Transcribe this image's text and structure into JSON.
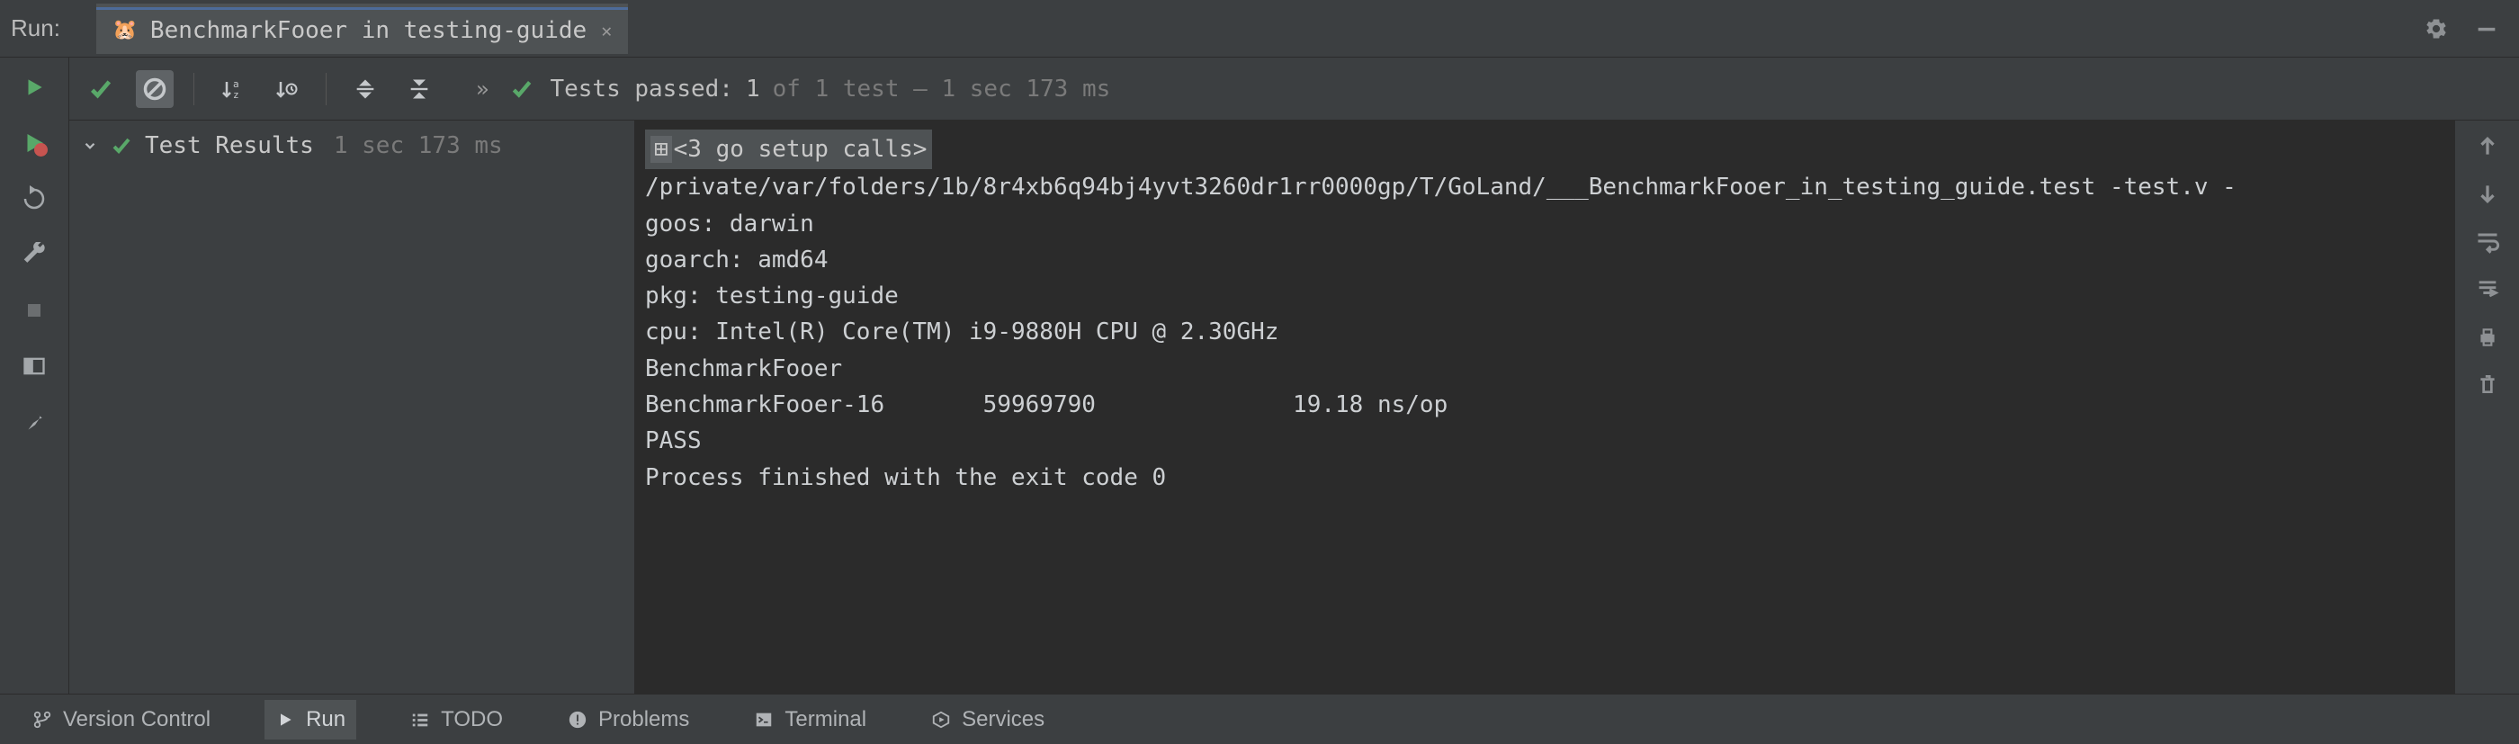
{
  "topbar": {
    "run_label": "Run:",
    "tab_icon": "🐹",
    "tab_title": "BenchmarkFooer in testing-guide"
  },
  "status": {
    "chevrons": "»",
    "label": "Tests passed:",
    "count": "1",
    "of_total": "of 1 test – 1 sec 173 ms"
  },
  "tree": {
    "root_label": "Test Results",
    "root_time": "1 sec 173 ms"
  },
  "console": {
    "setup": "<3 go setup calls>",
    "lines": [
      "/private/var/folders/1b/8r4xb6q94bj4yvt3260dr1rr0000gp/T/GoLand/___BenchmarkFooer_in_testing_guide.test -test.v -",
      "goos: darwin",
      "goarch: amd64",
      "pkg: testing-guide",
      "cpu: Intel(R) Core(TM) i9-9880H CPU @ 2.30GHz",
      "BenchmarkFooer",
      "BenchmarkFooer-16       59969790              19.18 ns/op",
      "PASS",
      "",
      "Process finished with the exit code 0"
    ]
  },
  "bottombar": {
    "version_control": "Version Control",
    "run": "Run",
    "todo": "TODO",
    "problems": "Problems",
    "terminal": "Terminal",
    "services": "Services"
  }
}
